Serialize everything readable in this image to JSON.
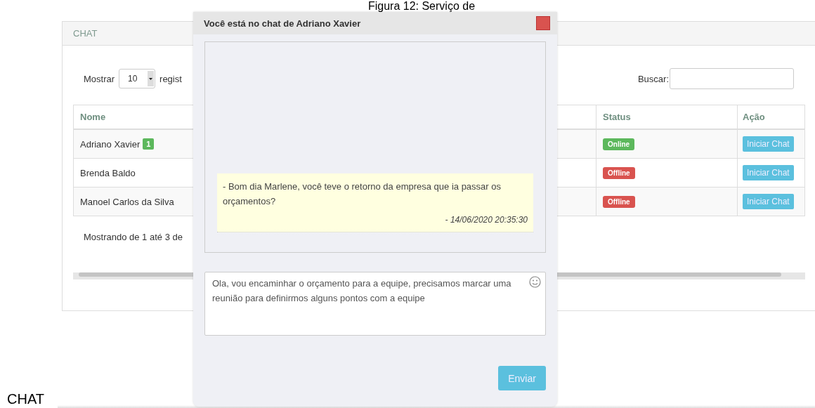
{
  "caption": "Figura 12: Serviço de",
  "panel": {
    "title": "CHAT",
    "length_label": "Mostrar",
    "length_value": "10",
    "length_suffix": "regist",
    "search_label": "Buscar:",
    "info": "Mostrando de 1 até 3 de"
  },
  "table": {
    "columns": [
      "Nome",
      "Status",
      "Ação"
    ],
    "rows": [
      {
        "name": "Adriano Xavier",
        "unread": "1",
        "status": {
          "kind": "online",
          "label": "Online"
        },
        "action": "Iniciar Chat"
      },
      {
        "name": "Brenda Baldo",
        "status": {
          "kind": "offline",
          "label": "Offline"
        },
        "action": "Iniciar Chat"
      },
      {
        "name": "Manoel Carlos da Silva",
        "status": {
          "kind": "offline",
          "label": "Offline"
        },
        "action": "Iniciar Chat"
      }
    ]
  },
  "chat": {
    "title": "Você está no chat de Adriano Xavier",
    "messages": [
      {
        "text": "- Bom dia Marlene, você teve o retorno da empresa que ia passar os orçamentos?",
        "time": "- 14/06/2020 20:35:30"
      }
    ],
    "draft": "Ola, vou encaminhar o orçamento para a equipe, precisamos marcar uma reunião para definirmos alguns pontos com a equipe",
    "send": "Enviar"
  },
  "footer_caption": "CHAT"
}
